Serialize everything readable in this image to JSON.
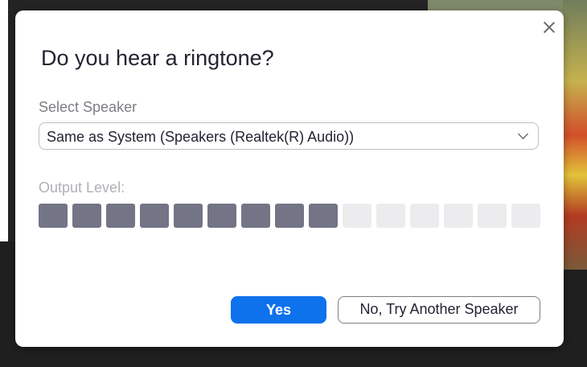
{
  "dialog": {
    "title": "Do you hear a ringtone?",
    "select_speaker_label": "Select Speaker",
    "speaker_selected": "Same as System (Speakers (Realtek(R) Audio))",
    "output_level_label": "Output Level:",
    "output_level": {
      "active_segments": 9,
      "total_segments": 15
    },
    "yes_label": "Yes",
    "try_another_label": "No, Try Another Speaker"
  },
  "colors": {
    "primary_button": "#0e72ed",
    "meter_active": "#747487",
    "meter_inactive": "#ececee",
    "title_text": "#232333",
    "muted_text": "#7d7d85"
  },
  "icons": {
    "close": "close-icon",
    "dropdown": "chevron-down-icon"
  }
}
